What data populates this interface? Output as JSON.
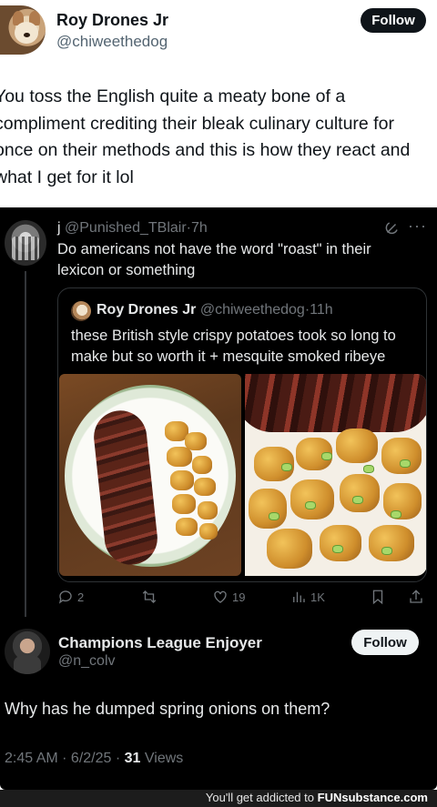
{
  "original_post": {
    "author_name": "Roy Drones Jr",
    "author_handle": "@chiweethedog",
    "follow_label": "Follow",
    "text": "You toss the English quite a meaty bone of a compliment crediting their bleak culinary culture for once on their methods and this is how they react and what I get for it lol"
  },
  "reply": {
    "author_name": "j",
    "author_handle": "@Punished_TBlair",
    "age": "7h",
    "more": "···",
    "text": "Do americans not have the word \"roast\" in their lexicon or something",
    "quote": {
      "author_name": "Roy Drones Jr",
      "author_handle": "@chiweethedog",
      "age": "11h",
      "text": "these British style crispy potatoes took so long to make but so worth it + mesquite smoked ribeye"
    },
    "actions": {
      "replies": "2",
      "reposts": "",
      "likes": "19",
      "views": "1K"
    }
  },
  "second_reply": {
    "author_name": "Champions League Enjoyer",
    "author_handle": "@n_colv",
    "follow_label": "Follow",
    "text": "Why has he dumped spring onions on them?",
    "time": "2:45 AM",
    "date": "6/2/25",
    "views_count": "31",
    "views_label": "Views"
  },
  "watermark": {
    "prefix": "You'll get addicted to",
    "brand": "FUNsubstance.com"
  },
  "icons": [
    "reply-icon",
    "repost-icon",
    "like-icon",
    "views-icon",
    "bookmark-icon",
    "share-icon",
    "grok-icon",
    "more-icon"
  ],
  "colors": {
    "dark_bg": "#000000",
    "text_primary_dark": "#e7e9ea",
    "text_secondary": "#71767b",
    "follow_dark": "#0f1419",
    "follow_light": "#eff3f4"
  }
}
